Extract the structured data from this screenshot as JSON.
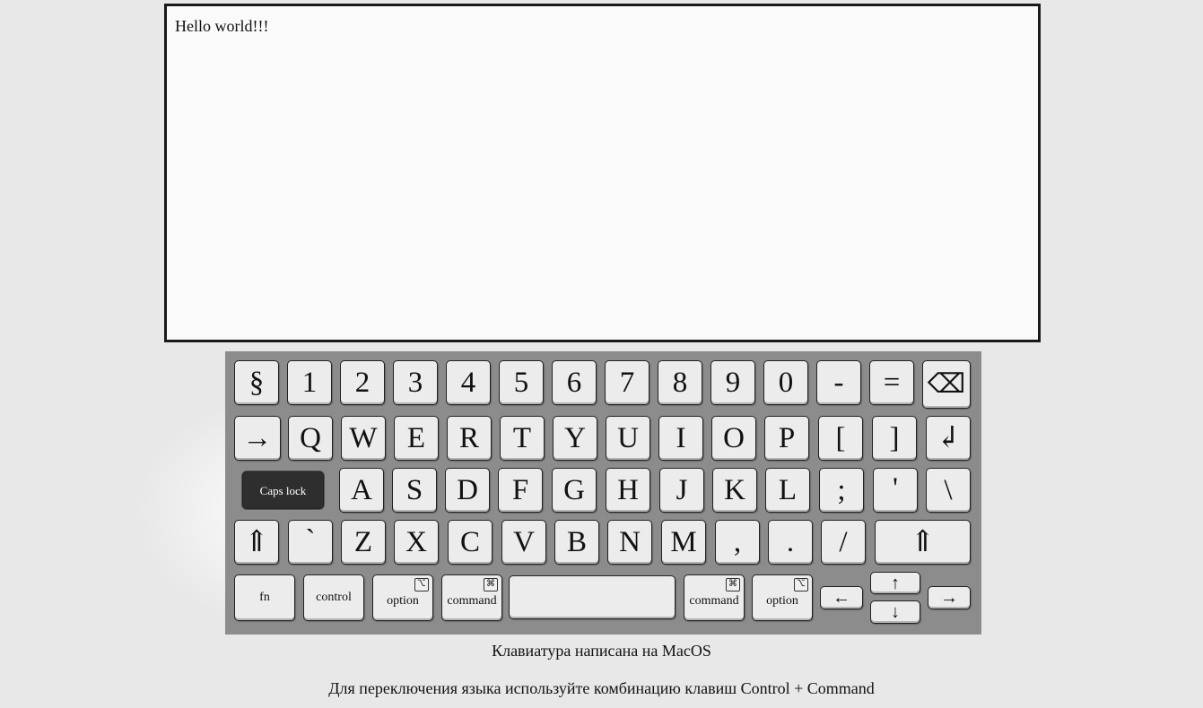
{
  "editor": {
    "text": "Hello world!!!"
  },
  "keyboard": {
    "row1": [
      "§",
      "1",
      "2",
      "3",
      "4",
      "5",
      "6",
      "7",
      "8",
      "9",
      "0",
      "-",
      "=",
      "⌫"
    ],
    "row2": [
      "→",
      "Q",
      "W",
      "E",
      "R",
      "T",
      "Y",
      "U",
      "I",
      "O",
      "P",
      "[",
      "]",
      "↲"
    ],
    "row3": [
      "Caps lock",
      "A",
      "S",
      "D",
      "F",
      "G",
      "H",
      "J",
      "K",
      "L",
      ";",
      "'",
      "\\"
    ],
    "row4": [
      "⇑",
      "`",
      "Z",
      "X",
      "C",
      "V",
      "B",
      "N",
      "M",
      ",",
      ".",
      "/",
      "⇑"
    ],
    "row5": {
      "fn": "fn",
      "control": "control",
      "option_left": "option",
      "option_symbol": "⌥",
      "command_left": "command",
      "command_symbol": "⌘",
      "space": "",
      "command_right": "command",
      "option_right": "option",
      "arrow_left": "←",
      "arrow_up": "↑",
      "arrow_down": "↓",
      "arrow_right": "→"
    },
    "caps_lock_active": true
  },
  "notes": {
    "line1": "Клавиатура написана на MacOS",
    "line2": "Для переключения языка используйте комбинацию клавиш Control + Command"
  }
}
